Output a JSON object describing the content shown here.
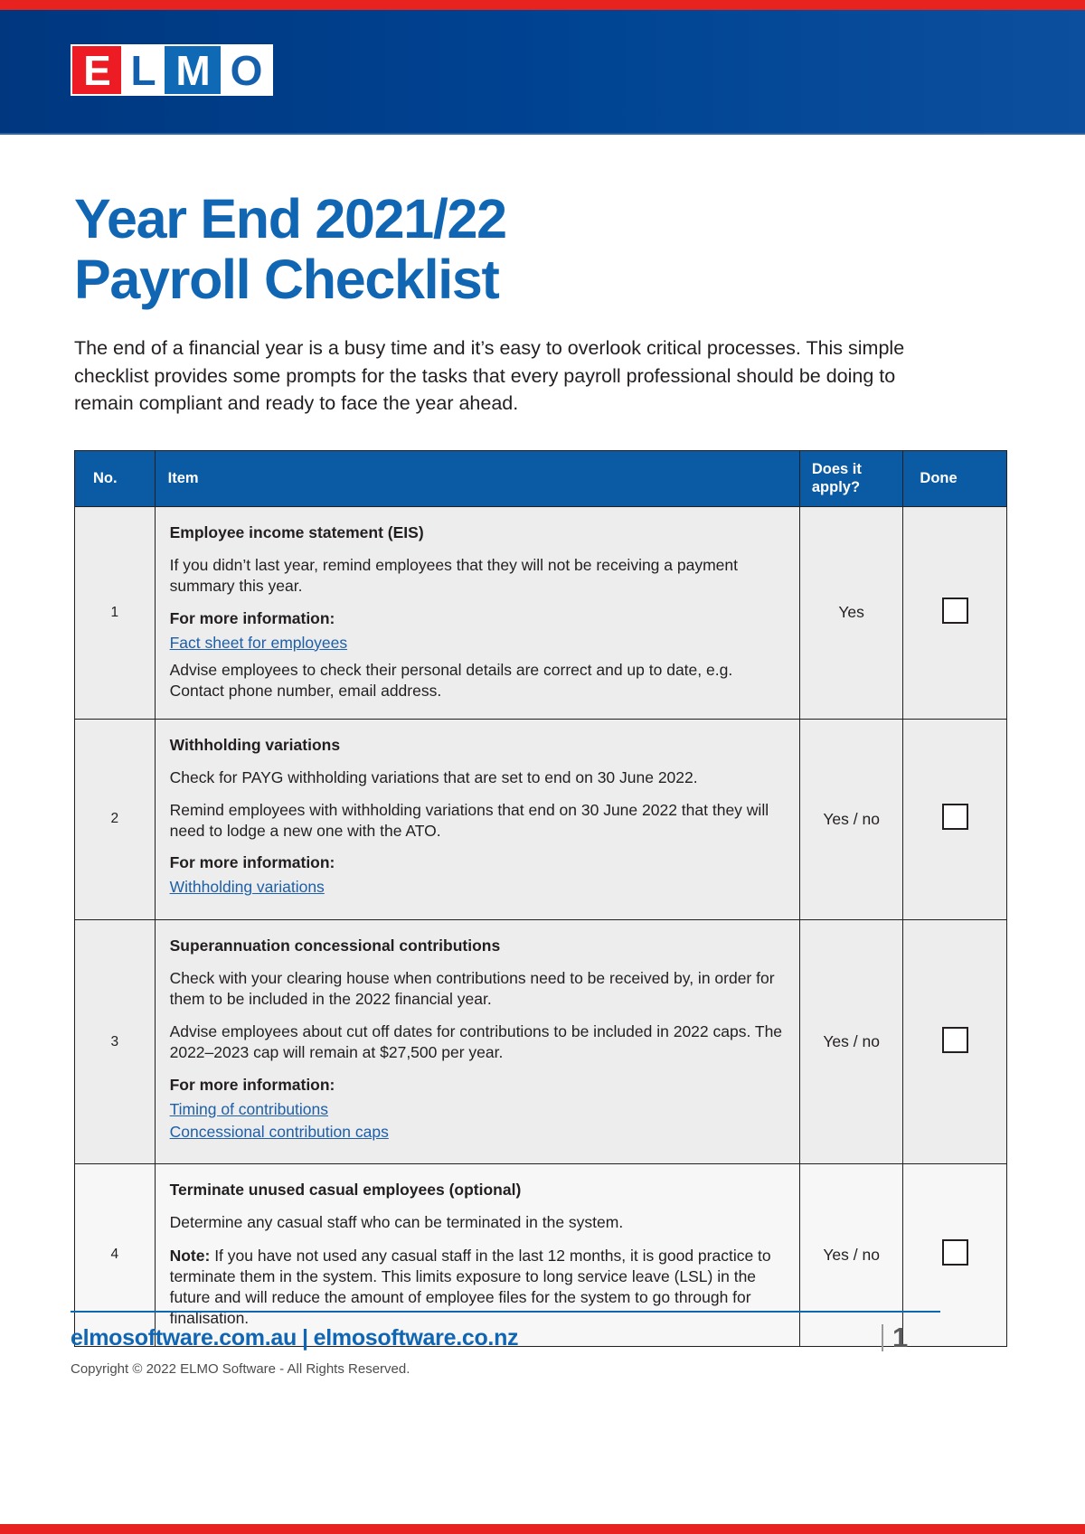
{
  "brand": {
    "logo_letters": [
      "E",
      "L",
      "M",
      "O"
    ],
    "accent_red": "#e8221f",
    "accent_blue": "#003f8e",
    "heading_blue": "#1066b3",
    "link_blue": "#1d5fa8"
  },
  "title": {
    "line1": "Year End 2021/22",
    "line2": "Payroll Checklist"
  },
  "intro": "The end of a financial year is a busy time and it’s easy to overlook critical processes. This simple checklist provides some prompts for the tasks that every payroll professional should be doing to remain compliant and ready to face the year ahead.",
  "table": {
    "headers": {
      "no": "No.",
      "item": "Item",
      "apply": "Does it apply?",
      "apply_line1": "Does it",
      "apply_line2": "apply?",
      "done": "Done"
    },
    "rows": [
      {
        "no": "1",
        "title": "Employee income statement (EIS)",
        "paragraphs": [
          "If you didn’t last year, remind employees that they will not be receiving a payment summary this year."
        ],
        "more_info_label": "For more information:",
        "links": [
          "Fact sheet for employees"
        ],
        "trailing_paragraphs": [
          "Advise employees to check their personal details are correct and up to date, e.g. Contact phone number, email address."
        ],
        "apply": "Yes",
        "done_checked": false
      },
      {
        "no": "2",
        "title": "Withholding variations",
        "paragraphs": [
          "Check for PAYG withholding variations that are set to end on 30 June 2022.",
          "Remind employees with withholding variations that end on 30 June 2022 that they will need to lodge a new one with the ATO."
        ],
        "more_info_label": "For more information:",
        "links": [
          "Withholding variations"
        ],
        "trailing_paragraphs": [],
        "apply": "Yes / no",
        "done_checked": false
      },
      {
        "no": "3",
        "title": "Superannuation concessional contributions",
        "paragraphs": [
          "Check with your clearing house when contributions need to be received by, in order for them to be included in the 2022 financial year.",
          "Advise employees about cut off dates for contributions to be included in 2022 caps. The 2022–2023 cap will remain at $27,500 per year."
        ],
        "more_info_label": "For more information:",
        "links": [
          "Timing of contributions",
          "Concessional contribution caps"
        ],
        "trailing_paragraphs": [],
        "apply": "Yes / no",
        "done_checked": false
      },
      {
        "no": "4",
        "title": "Terminate unused casual employees (optional)",
        "paragraphs": [
          "Determine any casual staff who can be terminated in the system."
        ],
        "note_prefix": "Note:",
        "note_text": " If you have not used any casual staff in the last 12 months, it is good practice to terminate them in the system. This limits exposure to long service leave (LSL) in the future and will reduce the amount of employee files for the system to go through for finalisation.",
        "more_info_label": "",
        "links": [],
        "trailing_paragraphs": [],
        "apply": "Yes / no",
        "done_checked": false
      }
    ]
  },
  "footer": {
    "site_au": "elmosoftware.com.au",
    "separator": "|",
    "site_nz": "elmosoftware.co.nz",
    "copyright": "Copyright © 2022 ELMO Software - All Rights Reserved.",
    "page_number": "1"
  }
}
